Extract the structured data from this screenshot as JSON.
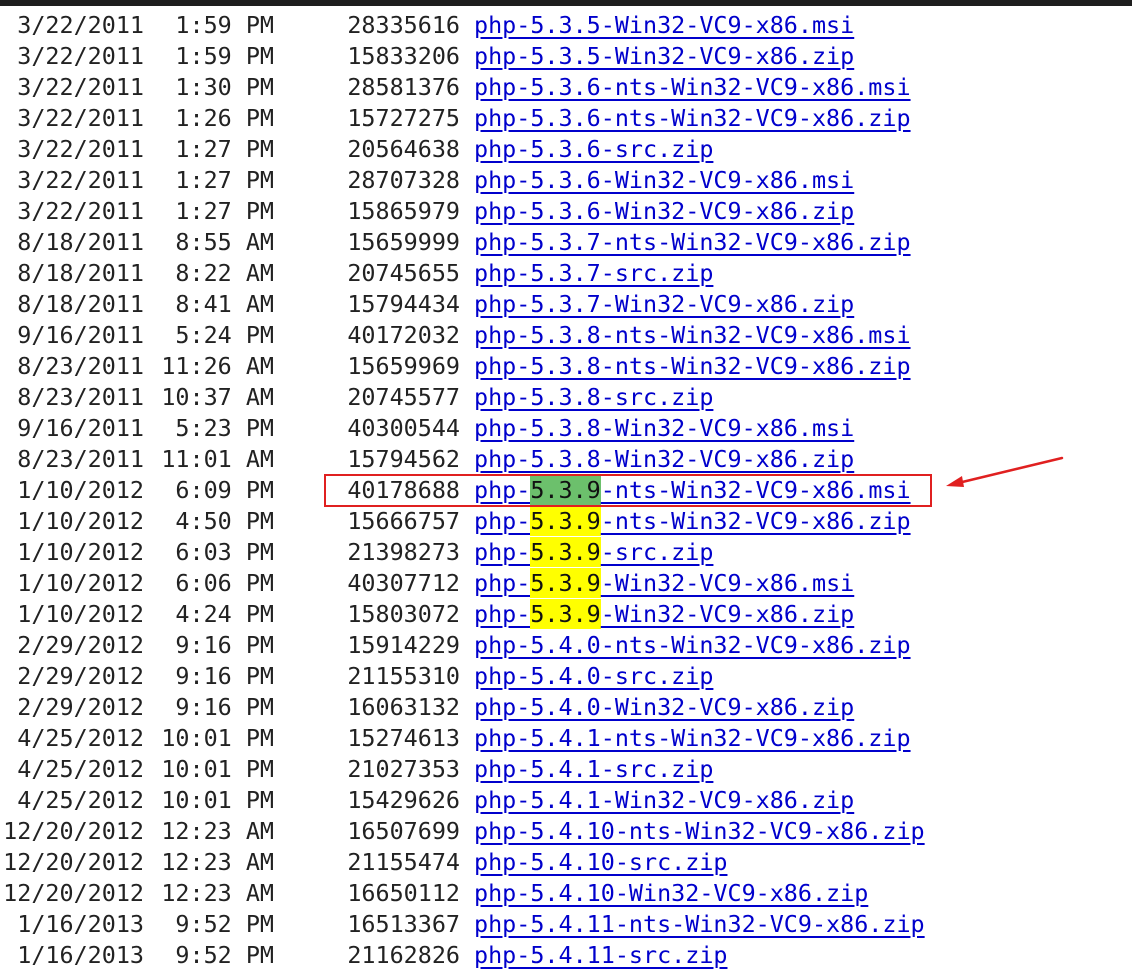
{
  "listing": {
    "rows": [
      {
        "date": "3/22/2011",
        "time": "1:59 PM",
        "size": "28335616",
        "file": "php-5.3.5-Win32-VC9-x86.msi"
      },
      {
        "date": "3/22/2011",
        "time": "1:59 PM",
        "size": "15833206",
        "file": "php-5.3.5-Win32-VC9-x86.zip"
      },
      {
        "date": "3/22/2011",
        "time": "1:30 PM",
        "size": "28581376",
        "file": "php-5.3.6-nts-Win32-VC9-x86.msi"
      },
      {
        "date": "3/22/2011",
        "time": "1:26 PM",
        "size": "15727275",
        "file": "php-5.3.6-nts-Win32-VC9-x86.zip"
      },
      {
        "date": "3/22/2011",
        "time": "1:27 PM",
        "size": "20564638",
        "file": "php-5.3.6-src.zip"
      },
      {
        "date": "3/22/2011",
        "time": "1:27 PM",
        "size": "28707328",
        "file": "php-5.3.6-Win32-VC9-x86.msi"
      },
      {
        "date": "3/22/2011",
        "time": "1:27 PM",
        "size": "15865979",
        "file": "php-5.3.6-Win32-VC9-x86.zip"
      },
      {
        "date": "8/18/2011",
        "time": "8:55 AM",
        "size": "15659999",
        "file": "php-5.3.7-nts-Win32-VC9-x86.zip"
      },
      {
        "date": "8/18/2011",
        "time": "8:22 AM",
        "size": "20745655",
        "file": "php-5.3.7-src.zip"
      },
      {
        "date": "8/18/2011",
        "time": "8:41 AM",
        "size": "15794434",
        "file": "php-5.3.7-Win32-VC9-x86.zip"
      },
      {
        "date": "9/16/2011",
        "time": "5:24 PM",
        "size": "40172032",
        "file": "php-5.3.8-nts-Win32-VC9-x86.msi"
      },
      {
        "date": "8/23/2011",
        "time": "11:26 AM",
        "size": "15659969",
        "file": "php-5.3.8-nts-Win32-VC9-x86.zip"
      },
      {
        "date": "8/23/2011",
        "time": "10:37 AM",
        "size": "20745577",
        "file": "php-5.3.8-src.zip"
      },
      {
        "date": "9/16/2011",
        "time": "5:23 PM",
        "size": "40300544",
        "file": "php-5.3.8-Win32-VC9-x86.msi"
      },
      {
        "date": "8/23/2011",
        "time": "11:01 AM",
        "size": "15794562",
        "file": "php-5.3.8-Win32-VC9-x86.zip"
      },
      {
        "date": "1/10/2012",
        "time": "6:09 PM",
        "size": "40178688",
        "file_pre": "php-",
        "file_hl": "5.3.9",
        "file_post": "-nts-Win32-VC9-x86.msi",
        "highlight": "green"
      },
      {
        "date": "1/10/2012",
        "time": "4:50 PM",
        "size": "15666757",
        "file_pre": "php-",
        "file_hl": "5.3.9",
        "file_post": "-nts-Win32-VC9-x86.zip",
        "highlight": "yellow"
      },
      {
        "date": "1/10/2012",
        "time": "6:03 PM",
        "size": "21398273",
        "file_pre": "php-",
        "file_hl": "5.3.9",
        "file_post": "-src.zip",
        "highlight": "yellow"
      },
      {
        "date": "1/10/2012",
        "time": "6:06 PM",
        "size": "40307712",
        "file_pre": "php-",
        "file_hl": "5.3.9",
        "file_post": "-Win32-VC9-x86.msi",
        "highlight": "yellow"
      },
      {
        "date": "1/10/2012",
        "time": "4:24 PM",
        "size": "15803072",
        "file_pre": "php-",
        "file_hl": "5.3.9",
        "file_post": "-Win32-VC9-x86.zip",
        "highlight": "yellow"
      },
      {
        "date": "2/29/2012",
        "time": "9:16 PM",
        "size": "15914229",
        "file": "php-5.4.0-nts-Win32-VC9-x86.zip"
      },
      {
        "date": "2/29/2012",
        "time": "9:16 PM",
        "size": "21155310",
        "file": "php-5.4.0-src.zip"
      },
      {
        "date": "2/29/2012",
        "time": "9:16 PM",
        "size": "16063132",
        "file": "php-5.4.0-Win32-VC9-x86.zip"
      },
      {
        "date": "4/25/2012",
        "time": "10:01 PM",
        "size": "15274613",
        "file": "php-5.4.1-nts-Win32-VC9-x86.zip"
      },
      {
        "date": "4/25/2012",
        "time": "10:01 PM",
        "size": "21027353",
        "file": "php-5.4.1-src.zip"
      },
      {
        "date": "4/25/2012",
        "time": "10:01 PM",
        "size": "15429626",
        "file": "php-5.4.1-Win32-VC9-x86.zip"
      },
      {
        "date": "12/20/2012",
        "time": "12:23 AM",
        "size": "16507699",
        "file": "php-5.4.10-nts-Win32-VC9-x86.zip"
      },
      {
        "date": "12/20/2012",
        "time": "12:23 AM",
        "size": "21155474",
        "file": "php-5.4.10-src.zip"
      },
      {
        "date": "12/20/2012",
        "time": "12:23 AM",
        "size": "16650112",
        "file": "php-5.4.10-Win32-VC9-x86.zip"
      },
      {
        "date": "1/16/2013",
        "time": "9:52 PM",
        "size": "16513367",
        "file": "php-5.4.11-nts-Win32-VC9-x86.zip"
      },
      {
        "date": "1/16/2013",
        "time": "9:52 PM",
        "size": "21162826",
        "file": "php-5.4.11-src.zip"
      }
    ]
  },
  "annotation": {
    "color": "#e02020"
  },
  "colors": {
    "link": "#0000cc",
    "text": "#222222",
    "highlight_yellow": "#ffff00",
    "highlight_green": "#6cc06c"
  }
}
